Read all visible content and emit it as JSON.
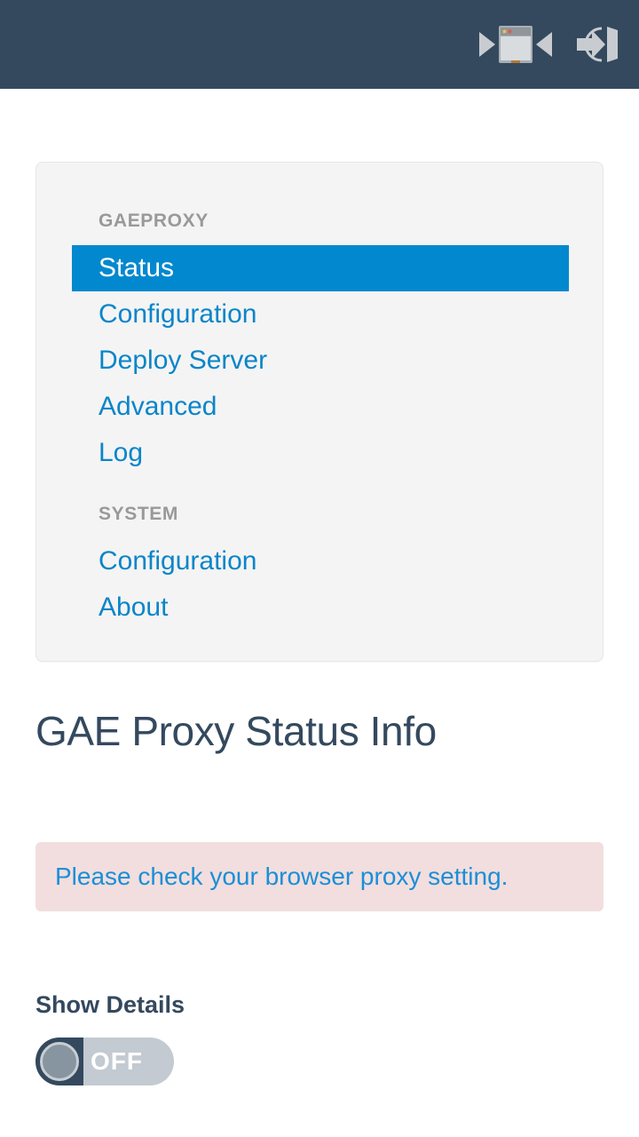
{
  "topbar": {
    "background": "#34495e",
    "actions": [
      {
        "name": "browser-window-collapse-icon",
        "label": "Toggle browser view"
      },
      {
        "name": "exit-icon",
        "label": "Exit"
      }
    ]
  },
  "nav": {
    "sections": [
      {
        "label": "GAEPROXY",
        "items": [
          {
            "label": "Status",
            "active": true
          },
          {
            "label": "Configuration",
            "active": false
          },
          {
            "label": "Deploy Server",
            "active": false
          },
          {
            "label": "Advanced",
            "active": false
          },
          {
            "label": "Log",
            "active": false
          }
        ]
      },
      {
        "label": "SYSTEM",
        "items": [
          {
            "label": "Configuration",
            "active": false
          },
          {
            "label": "About",
            "active": false
          }
        ]
      }
    ],
    "active_color": "#0288ce",
    "link_color": "#0a85c9",
    "section_label_color": "#999999",
    "card_background": "#f4f4f4"
  },
  "main": {
    "title": "GAE Proxy Status Info",
    "title_color": "#34495e",
    "alert": {
      "text": "Please check your browser proxy setting.",
      "background": "#f2dede",
      "text_color": "#1a8fd8"
    },
    "toggle": {
      "label": "Show Details",
      "state": "OFF",
      "checked": false,
      "track_color": "#c3cad1",
      "knob_color": "#8795a1"
    }
  }
}
